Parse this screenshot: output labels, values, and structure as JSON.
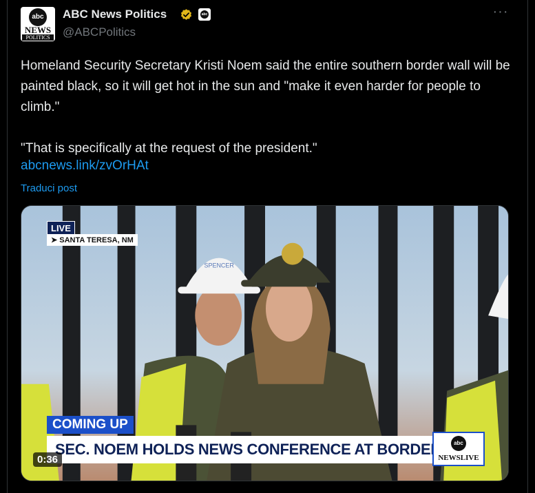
{
  "account": {
    "display_name": "ABC News Politics",
    "handle": "@ABCPolitics",
    "avatar_text": {
      "badge": "abc",
      "line1": "NEWS",
      "line2": "POLITICS"
    },
    "affiliate_badge_text": "abc",
    "verified_color": "#e2b719"
  },
  "tweet": {
    "text": "Homeland Security Secretary Kristi Noem said the entire southern border wall will be painted black, so it will get hot in the sun and \"make it even harder for people to climb.\"\n\n\"That is specifically at the request of the president.\"",
    "link": "abcnews.link/zvOrHAt",
    "translate_label": "Traduci post",
    "more_label": "···"
  },
  "video": {
    "live_label": "LIVE",
    "location": "SANTA TERESA, NM",
    "coming_up": "COMING UP",
    "headline": "SEC. NOEM HOLDS NEWS CONFERENCE AT BORDER WALL",
    "brand_logo": "abc",
    "brand_text": "NEWSLIVE",
    "duration": "0:36",
    "helmet_label": "SPENCER"
  },
  "colors": {
    "background": "#000000",
    "text": "#e7e9ea",
    "muted": "#71767b",
    "link": "#1d9bf0",
    "abc_blue": "#1b4fc9"
  }
}
